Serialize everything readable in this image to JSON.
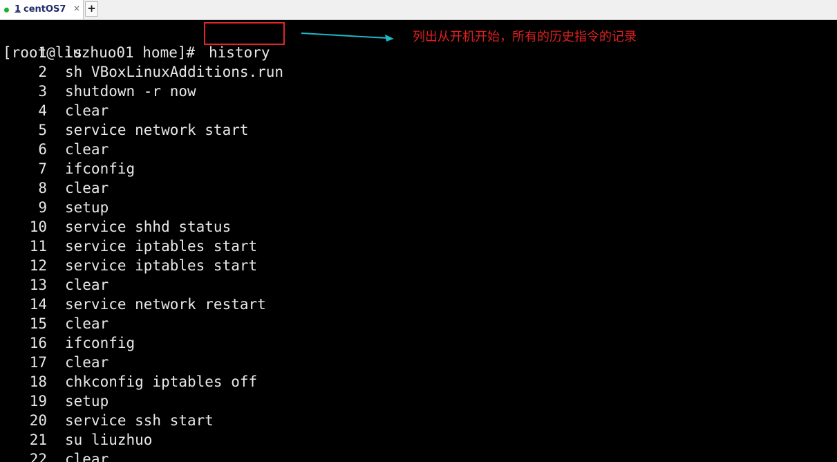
{
  "tabs": [
    {
      "number": "1",
      "title": "centOS7",
      "close": "×",
      "status_color": "#19b12a"
    }
  ],
  "new_tab_label": "+",
  "terminal": {
    "prompt": "[root@liuzhuo01 home]#",
    "command": "history",
    "history": [
      {
        "n": "1",
        "cmd": "ls"
      },
      {
        "n": "2",
        "cmd": "sh VBoxLinuxAdditions.run"
      },
      {
        "n": "3",
        "cmd": "shutdown -r now"
      },
      {
        "n": "4",
        "cmd": "clear"
      },
      {
        "n": "5",
        "cmd": "service network start"
      },
      {
        "n": "6",
        "cmd": "clear"
      },
      {
        "n": "7",
        "cmd": "ifconfig"
      },
      {
        "n": "8",
        "cmd": "clear"
      },
      {
        "n": "9",
        "cmd": "setup"
      },
      {
        "n": "10",
        "cmd": "service shhd status"
      },
      {
        "n": "11",
        "cmd": "service iptables start"
      },
      {
        "n": "12",
        "cmd": "service iptables start"
      },
      {
        "n": "13",
        "cmd": "clear"
      },
      {
        "n": "14",
        "cmd": "service network restart"
      },
      {
        "n": "15",
        "cmd": "clear"
      },
      {
        "n": "16",
        "cmd": "ifconfig"
      },
      {
        "n": "17",
        "cmd": "clear"
      },
      {
        "n": "18",
        "cmd": "chkconfig iptables off"
      },
      {
        "n": "19",
        "cmd": "setup"
      },
      {
        "n": "20",
        "cmd": "service ssh start"
      },
      {
        "n": "21",
        "cmd": "su liuzhuo"
      },
      {
        "n": "22",
        "cmd": "clear"
      }
    ]
  },
  "annotation": {
    "text": "列出从开机开始，所有的历史指令的记录",
    "text_color": "#e02020",
    "box_color": "#e0262b",
    "arrow_color": "#1fb8c8"
  },
  "colors": {
    "terminal_bg": "#000000",
    "terminal_fg": "#e8e8e8",
    "tab_text": "#1f2a6b"
  }
}
